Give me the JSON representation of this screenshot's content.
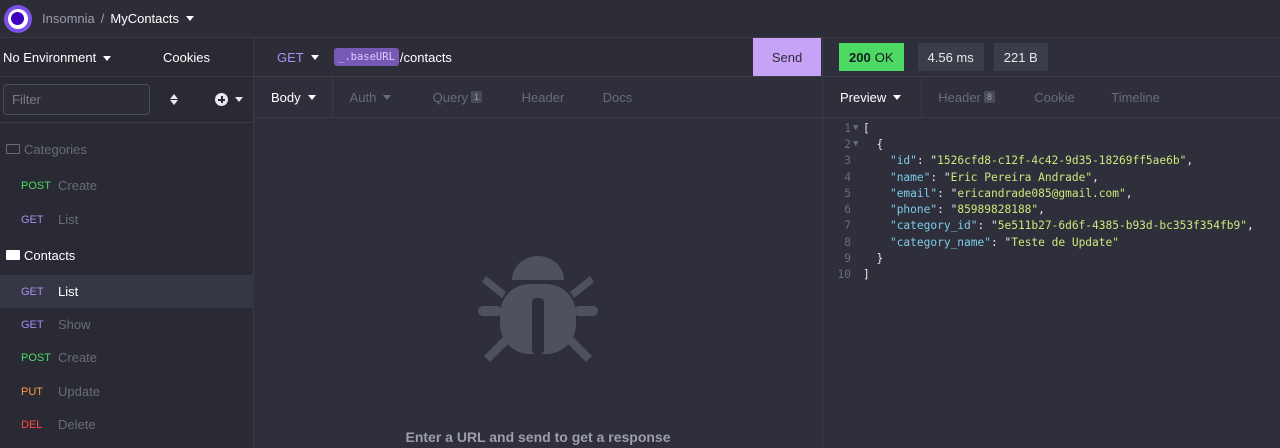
{
  "app": {
    "name": "Insomnia",
    "separator": "/",
    "project": "MyContacts"
  },
  "sidebar": {
    "environment": "No Environment",
    "cookies": "Cookies",
    "filter_placeholder": "Filter",
    "folders": [
      {
        "name": "Categories",
        "requests": [
          {
            "method": "POST",
            "name": "Create"
          },
          {
            "method": "GET",
            "name": "List"
          }
        ]
      },
      {
        "name": "Contacts",
        "requests": [
          {
            "method": "GET",
            "name": "List"
          },
          {
            "method": "GET",
            "name": "Show"
          },
          {
            "method": "POST",
            "name": "Create"
          },
          {
            "method": "PUT",
            "name": "Update"
          },
          {
            "method": "DEL",
            "name": "Delete"
          }
        ]
      }
    ]
  },
  "request": {
    "method": "GET",
    "url_variable": "_.baseURL",
    "url_path": "/contacts",
    "send_label": "Send",
    "tabs": {
      "body": "Body",
      "auth": "Auth",
      "query": "Query",
      "query_count": "1",
      "header": "Header",
      "docs": "Docs"
    },
    "empty_message": "Enter a URL and send to get a response"
  },
  "response": {
    "status_code": "200",
    "status_text": "OK",
    "time": "4.56 ms",
    "size": "221 B",
    "tabs": {
      "preview": "Preview",
      "header": "Header",
      "header_count": "8",
      "cookie": "Cookie",
      "timeline": "Timeline"
    },
    "lines": [
      {
        "n": "1",
        "fold": true
      },
      {
        "n": "2",
        "fold": true
      },
      {
        "n": "3"
      },
      {
        "n": "4"
      },
      {
        "n": "5"
      },
      {
        "n": "6"
      },
      {
        "n": "7"
      },
      {
        "n": "8"
      },
      {
        "n": "9"
      },
      {
        "n": "10"
      }
    ],
    "json": {
      "id": "1526cfd8-c12f-4c42-9d35-18269ff5ae6b",
      "name": "Eric Pereira Andrade",
      "email": "ericandrade085@gmail.com",
      "phone": "85989828188",
      "category_id": "5e511b27-6d6f-4385-b93d-bc353f354fb9",
      "category_name": "Teste de Update"
    }
  },
  "colors": {
    "accent": "#7b51e8",
    "send": "#c6a3f6",
    "ok": "#4cd964",
    "get": "#a88ef5",
    "post": "#4cd964",
    "put": "#ff9a3c",
    "del": "#ff4b4b"
  }
}
